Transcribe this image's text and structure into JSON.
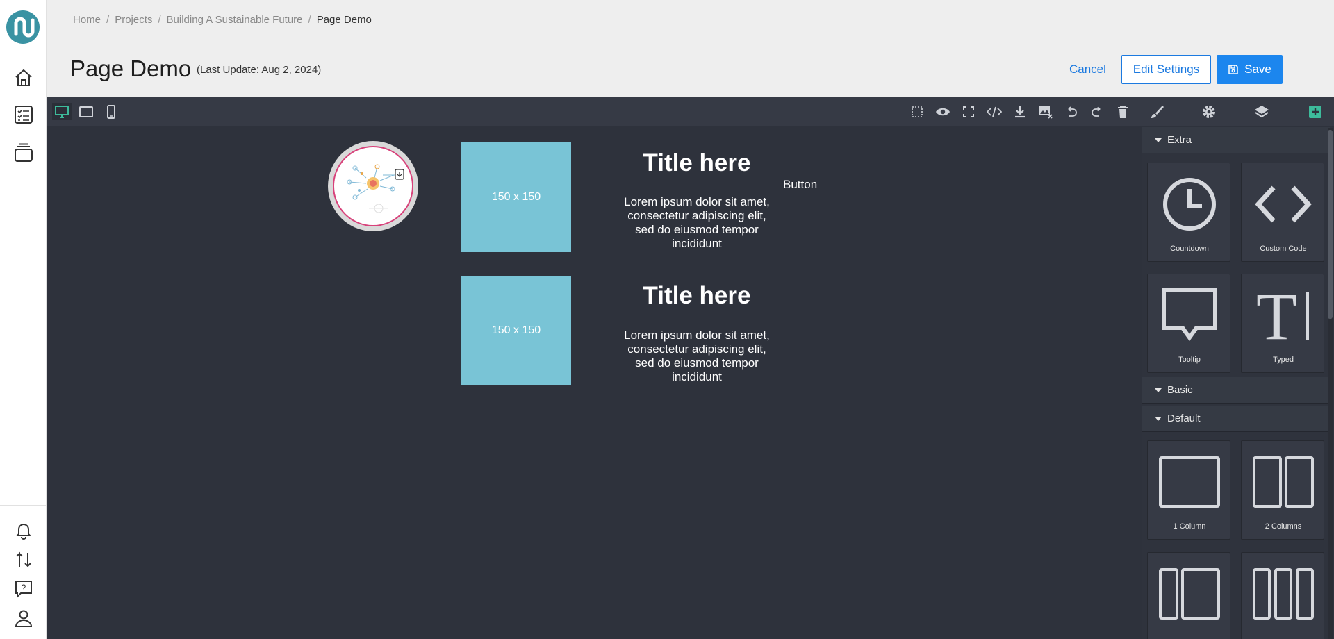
{
  "breadcrumb": [
    "Home",
    "Projects",
    "Building A Sustainable Future",
    "Page Demo"
  ],
  "page": {
    "title": "Page Demo",
    "last_update": "(Last Update: Aug 2, 2024)"
  },
  "actions": {
    "cancel": "Cancel",
    "edit_settings": "Edit Settings",
    "save": "Save"
  },
  "colors": {
    "accent": "#1c86ee",
    "active_green": "#3dbb9b",
    "placeholder": "#79c4d6",
    "editor_bg": "#2e323c"
  },
  "canvas": {
    "cards": [
      {
        "placeholder": "150 x 150",
        "title": "Title here",
        "text": "Lorem ipsum dolor sit amet, consectetur adipiscing elit, sed do eiusmod tempor incididunt"
      },
      {
        "placeholder": "150 x 150",
        "title": "Title here",
        "text": "Lorem ipsum dolor sit amet, consectetur adipiscing elit, sed do eiusmod tempor incididunt"
      }
    ],
    "button": "Button"
  },
  "panel": {
    "sections": {
      "extra": "Extra",
      "basic": "Basic",
      "default": "Default"
    },
    "extra_blocks": [
      "Countdown",
      "Custom Code",
      "Tooltip",
      "Typed"
    ],
    "default_blocks": [
      "1 Column",
      "2 Columns"
    ]
  }
}
